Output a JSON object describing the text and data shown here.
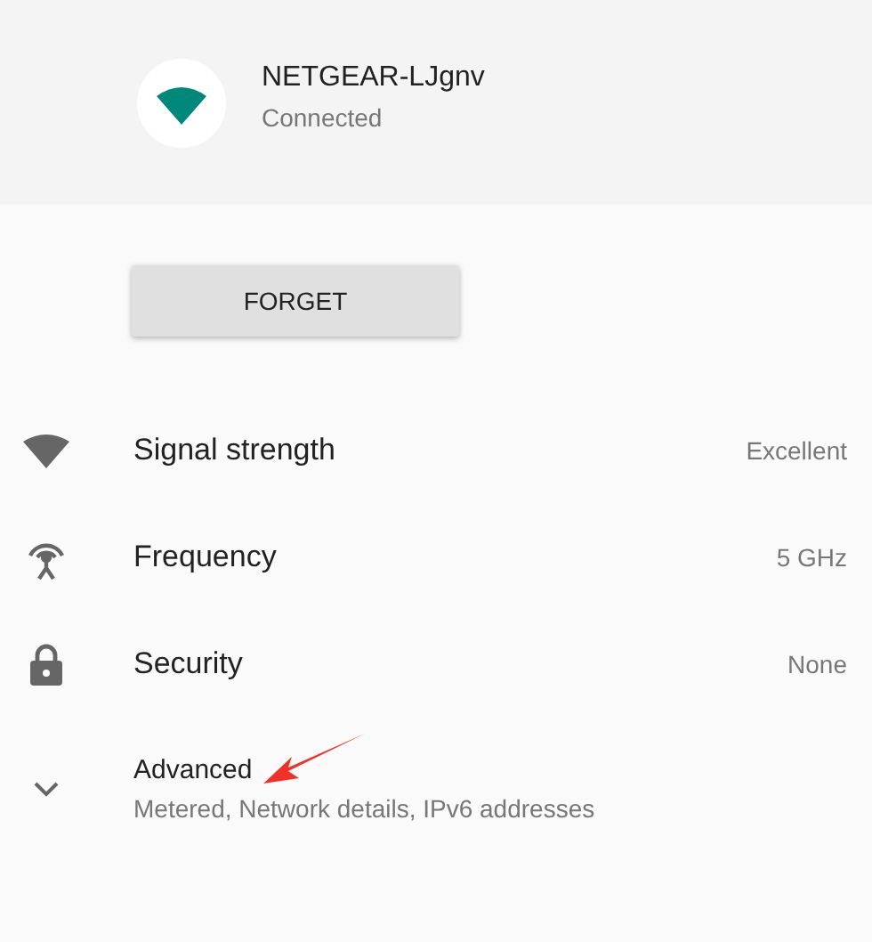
{
  "network": {
    "name": "NETGEAR-LJgnv",
    "status": "Connected"
  },
  "forget_button": "FORGET",
  "details": [
    {
      "kind": "signal",
      "label": "Signal strength",
      "value": "Excellent"
    },
    {
      "kind": "frequency",
      "label": "Frequency",
      "value": "5 GHz"
    },
    {
      "kind": "security",
      "label": "Security",
      "value": "None"
    }
  ],
  "advanced": {
    "title": "Advanced",
    "summary": "Metered, Network details, IPv6 addresses",
    "expanded": false
  }
}
